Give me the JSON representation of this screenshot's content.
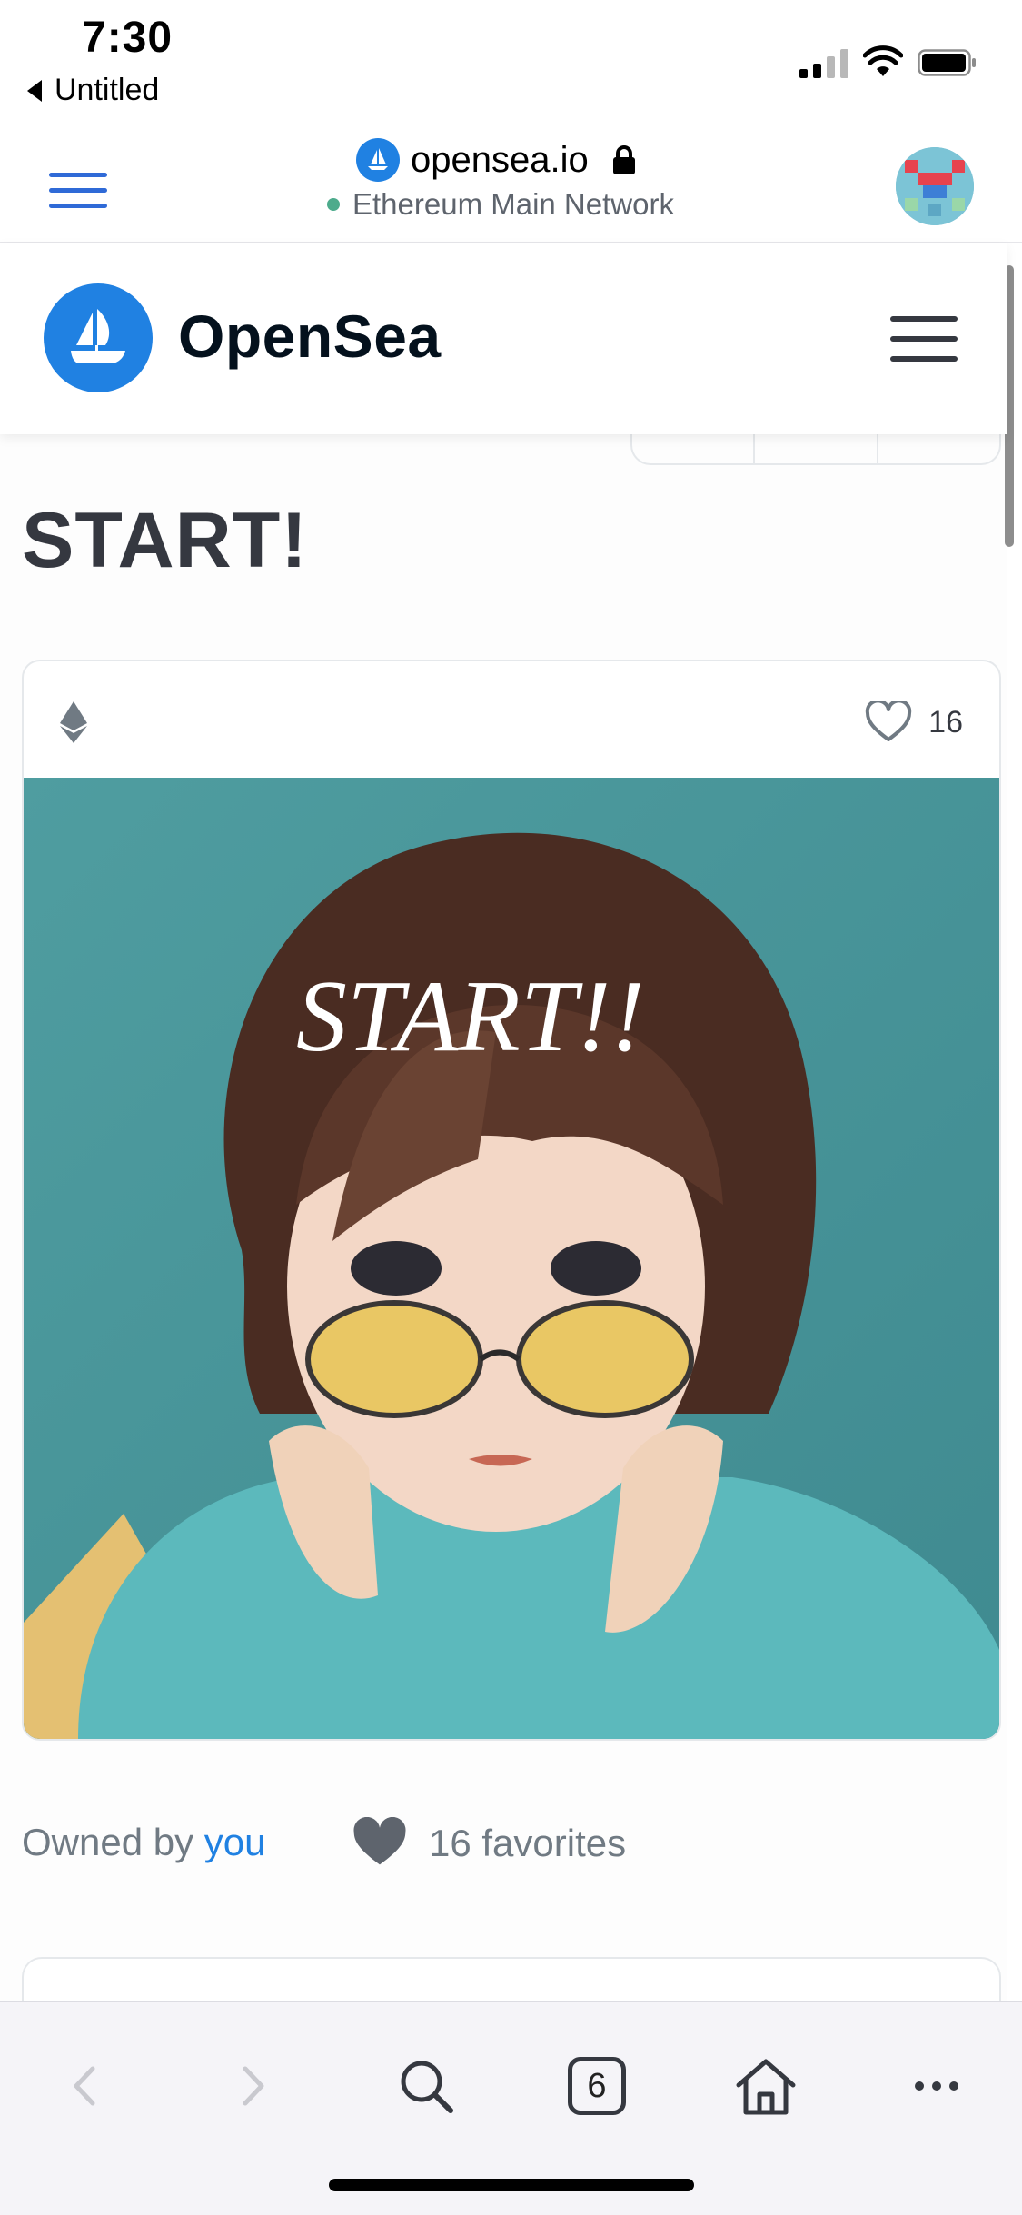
{
  "status_bar": {
    "time": "7:30",
    "back_label": "Untitled"
  },
  "wallet_browser": {
    "url": "opensea.io",
    "network": "Ethereum Main Network",
    "icons": {
      "menu": "hamburger-icon",
      "lock": "lock-icon",
      "favicon": "opensea-favicon-icon",
      "avatar": "pixel-avatar"
    }
  },
  "site_header": {
    "brand": "OpenSea",
    "icons": {
      "logo": "opensea-sailboat-logo",
      "menu": "hamburger-icon"
    }
  },
  "item": {
    "title": "START!",
    "favorite_count": "16",
    "artwork_text": "START!!",
    "owner_prefix": "Owned by",
    "owner_link": "you",
    "favorites_label": "16 favorites"
  },
  "toolbar": {
    "tabs_count": "6",
    "icons": [
      "chevron-left-icon",
      "chevron-right-icon",
      "search-icon",
      "tabs-icon",
      "home-icon",
      "more-icon"
    ]
  },
  "colors": {
    "accent": "#2081e2",
    "title": "#353840",
    "muted": "#707a83",
    "network_dot": "#4dab8c"
  }
}
